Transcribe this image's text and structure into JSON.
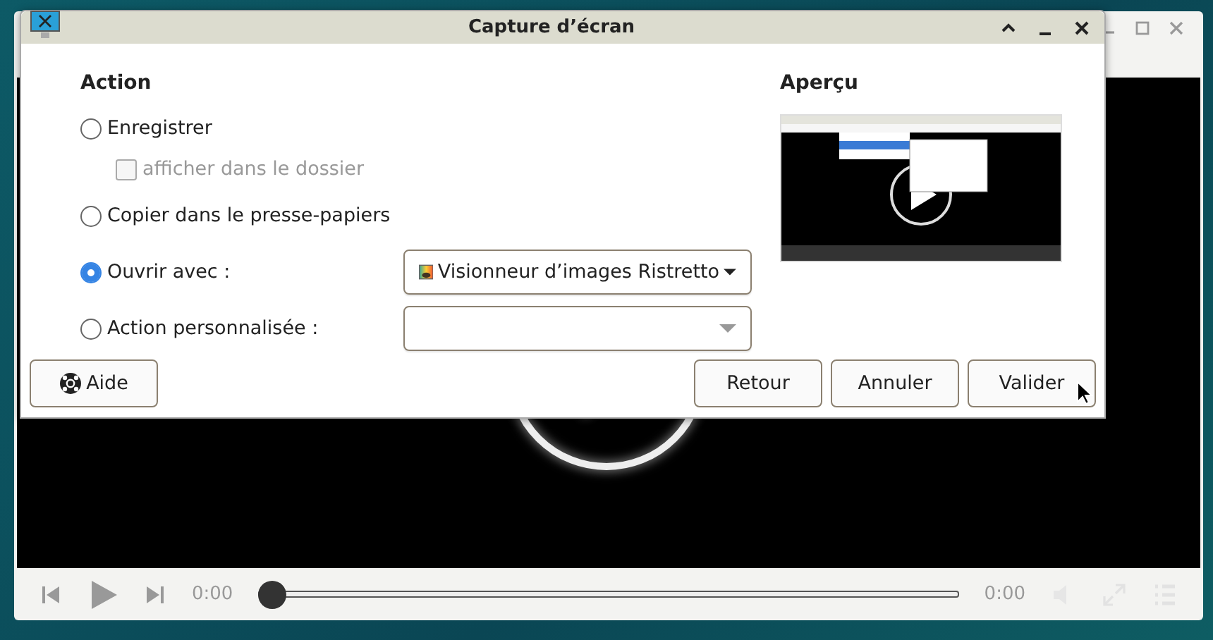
{
  "player": {
    "time_elapsed": "0:00",
    "time_total": "0:00",
    "seek": {
      "level": 0
    }
  },
  "dialog": {
    "title": "Capture d’écran",
    "action_heading": "Action",
    "options": [
      {
        "kind": "plain",
        "label": "Enregistrer",
        "selected": false,
        "sub": {
          "label": "afficher dans le dossier",
          "checked": false,
          "disabled": true
        }
      },
      {
        "kind": "plain",
        "label": "Copier dans le presse-papiers",
        "selected": false
      },
      {
        "kind": "dropdown",
        "label": "Ouvrir avec :",
        "selected": true,
        "value": "Visionneur d’images Ristretto"
      },
      {
        "kind": "dropdown",
        "label": "Action personnalisée :",
        "selected": false
      }
    ],
    "preview_heading": "Aperçu",
    "help_button": "Aide",
    "buttons": [
      "Retour",
      "Annuler",
      "Valider"
    ]
  }
}
